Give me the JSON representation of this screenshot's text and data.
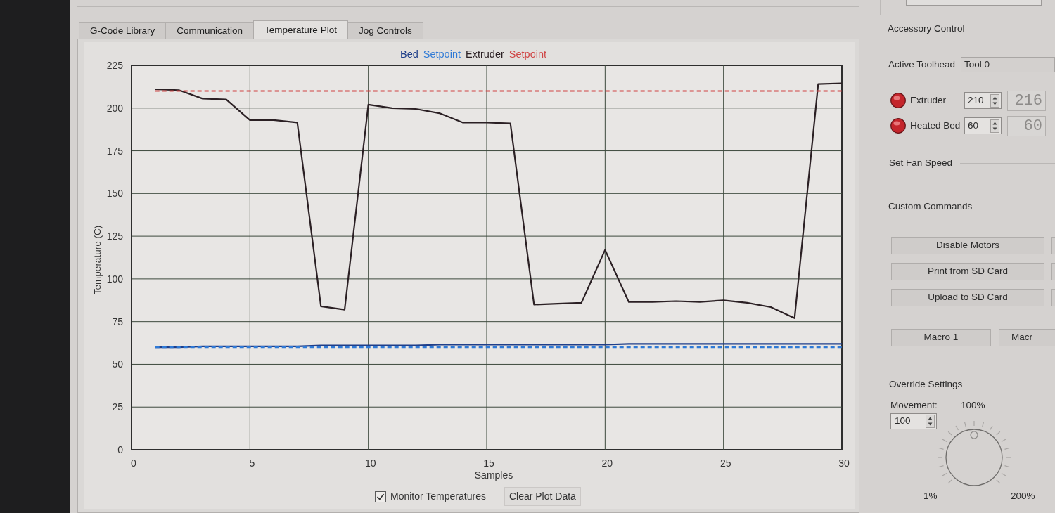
{
  "tabs": [
    {
      "label": "G-Code Library",
      "selected": false
    },
    {
      "label": "Communication",
      "selected": false
    },
    {
      "label": "Temperature Plot",
      "selected": true
    },
    {
      "label": "Jog Controls",
      "selected": false
    }
  ],
  "temperature_plot": {
    "chart_data": {
      "type": "line",
      "xlabel": "Samples",
      "ylabel": "Temperature (C)",
      "x": [
        1,
        2,
        3,
        4,
        5,
        6,
        7,
        8,
        9,
        10,
        11,
        12,
        13,
        14,
        15,
        16,
        17,
        18,
        19,
        20,
        21,
        22,
        23,
        24,
        25,
        26,
        27,
        28,
        29,
        30
      ],
      "series": [
        {
          "name": "Bed",
          "line_style": "solid",
          "color": "#1f3f8a",
          "values": [
            60,
            60,
            60.5,
            60.5,
            60.5,
            60.5,
            60.5,
            61,
            61,
            61,
            61,
            61,
            61.5,
            61.5,
            61.5,
            61.5,
            61.5,
            61.5,
            61.5,
            61.5,
            62,
            62,
            62,
            62,
            62,
            62,
            62,
            62,
            62,
            62
          ]
        },
        {
          "name": "Setpoint",
          "line_style": "dashed",
          "color": "#2f7ad6",
          "values": [
            60,
            60,
            60,
            60,
            60,
            60,
            60,
            60,
            60,
            60,
            60,
            60,
            60,
            60,
            60,
            60,
            60,
            60,
            60,
            60,
            60,
            60,
            60,
            60,
            60,
            60,
            60,
            60,
            60,
            60
          ]
        },
        {
          "name": "Extruder",
          "line_style": "solid",
          "color": "#2b2024",
          "values": [
            211,
            210.5,
            205.5,
            205,
            193,
            193,
            191.5,
            84,
            82,
            202,
            200,
            199.5,
            197,
            191.5,
            191.5,
            191,
            85,
            85.5,
            86,
            117,
            86.5,
            86.5,
            87,
            86.5,
            87.5,
            86,
            83.5,
            77,
            214,
            214.5
          ]
        },
        {
          "name": "Setpoint",
          "line_style": "dashed",
          "color": "#d04545",
          "values": [
            210,
            210,
            210,
            210,
            210,
            210,
            210,
            210,
            210,
            210,
            210,
            210,
            210,
            210,
            210,
            210,
            210,
            210,
            210,
            210,
            210,
            210,
            210,
            210,
            210,
            210,
            210,
            210,
            210,
            210
          ]
        }
      ],
      "xlim": [
        0,
        30
      ],
      "ylim": [
        0,
        225
      ],
      "xticks": [
        0,
        5,
        10,
        15,
        20,
        25,
        30
      ],
      "yticks": [
        0,
        25,
        50,
        75,
        100,
        125,
        150,
        175,
        200,
        225
      ],
      "grid": true
    },
    "monitor_temperatures": {
      "label": "Monitor Temperatures",
      "checked": true
    },
    "clear_button": "Clear Plot Data"
  },
  "accessory_control": {
    "title": "Accessory Control",
    "active_toolhead": {
      "label": "Active Toolhead",
      "value": "Tool 0"
    },
    "heaters": [
      {
        "label": "Extruder",
        "on": true,
        "setpoint": "210",
        "reading": "216"
      },
      {
        "label": "Heated Bed",
        "on": true,
        "setpoint": "60",
        "reading": "60"
      }
    ],
    "fan_speed": {
      "label": "Set Fan Speed"
    }
  },
  "custom_commands": {
    "title": "Custom Commands",
    "buttons": [
      "Disable Motors",
      "Print from SD Card",
      "Upload to SD Card"
    ],
    "macros": [
      "Macro 1",
      "Macr"
    ]
  },
  "override_settings": {
    "title": "Override Settings",
    "movement": {
      "label": "Movement:",
      "reading": "100%",
      "value": "100",
      "level": 0.5,
      "min_label": "1%",
      "max_label": "200%"
    }
  }
}
